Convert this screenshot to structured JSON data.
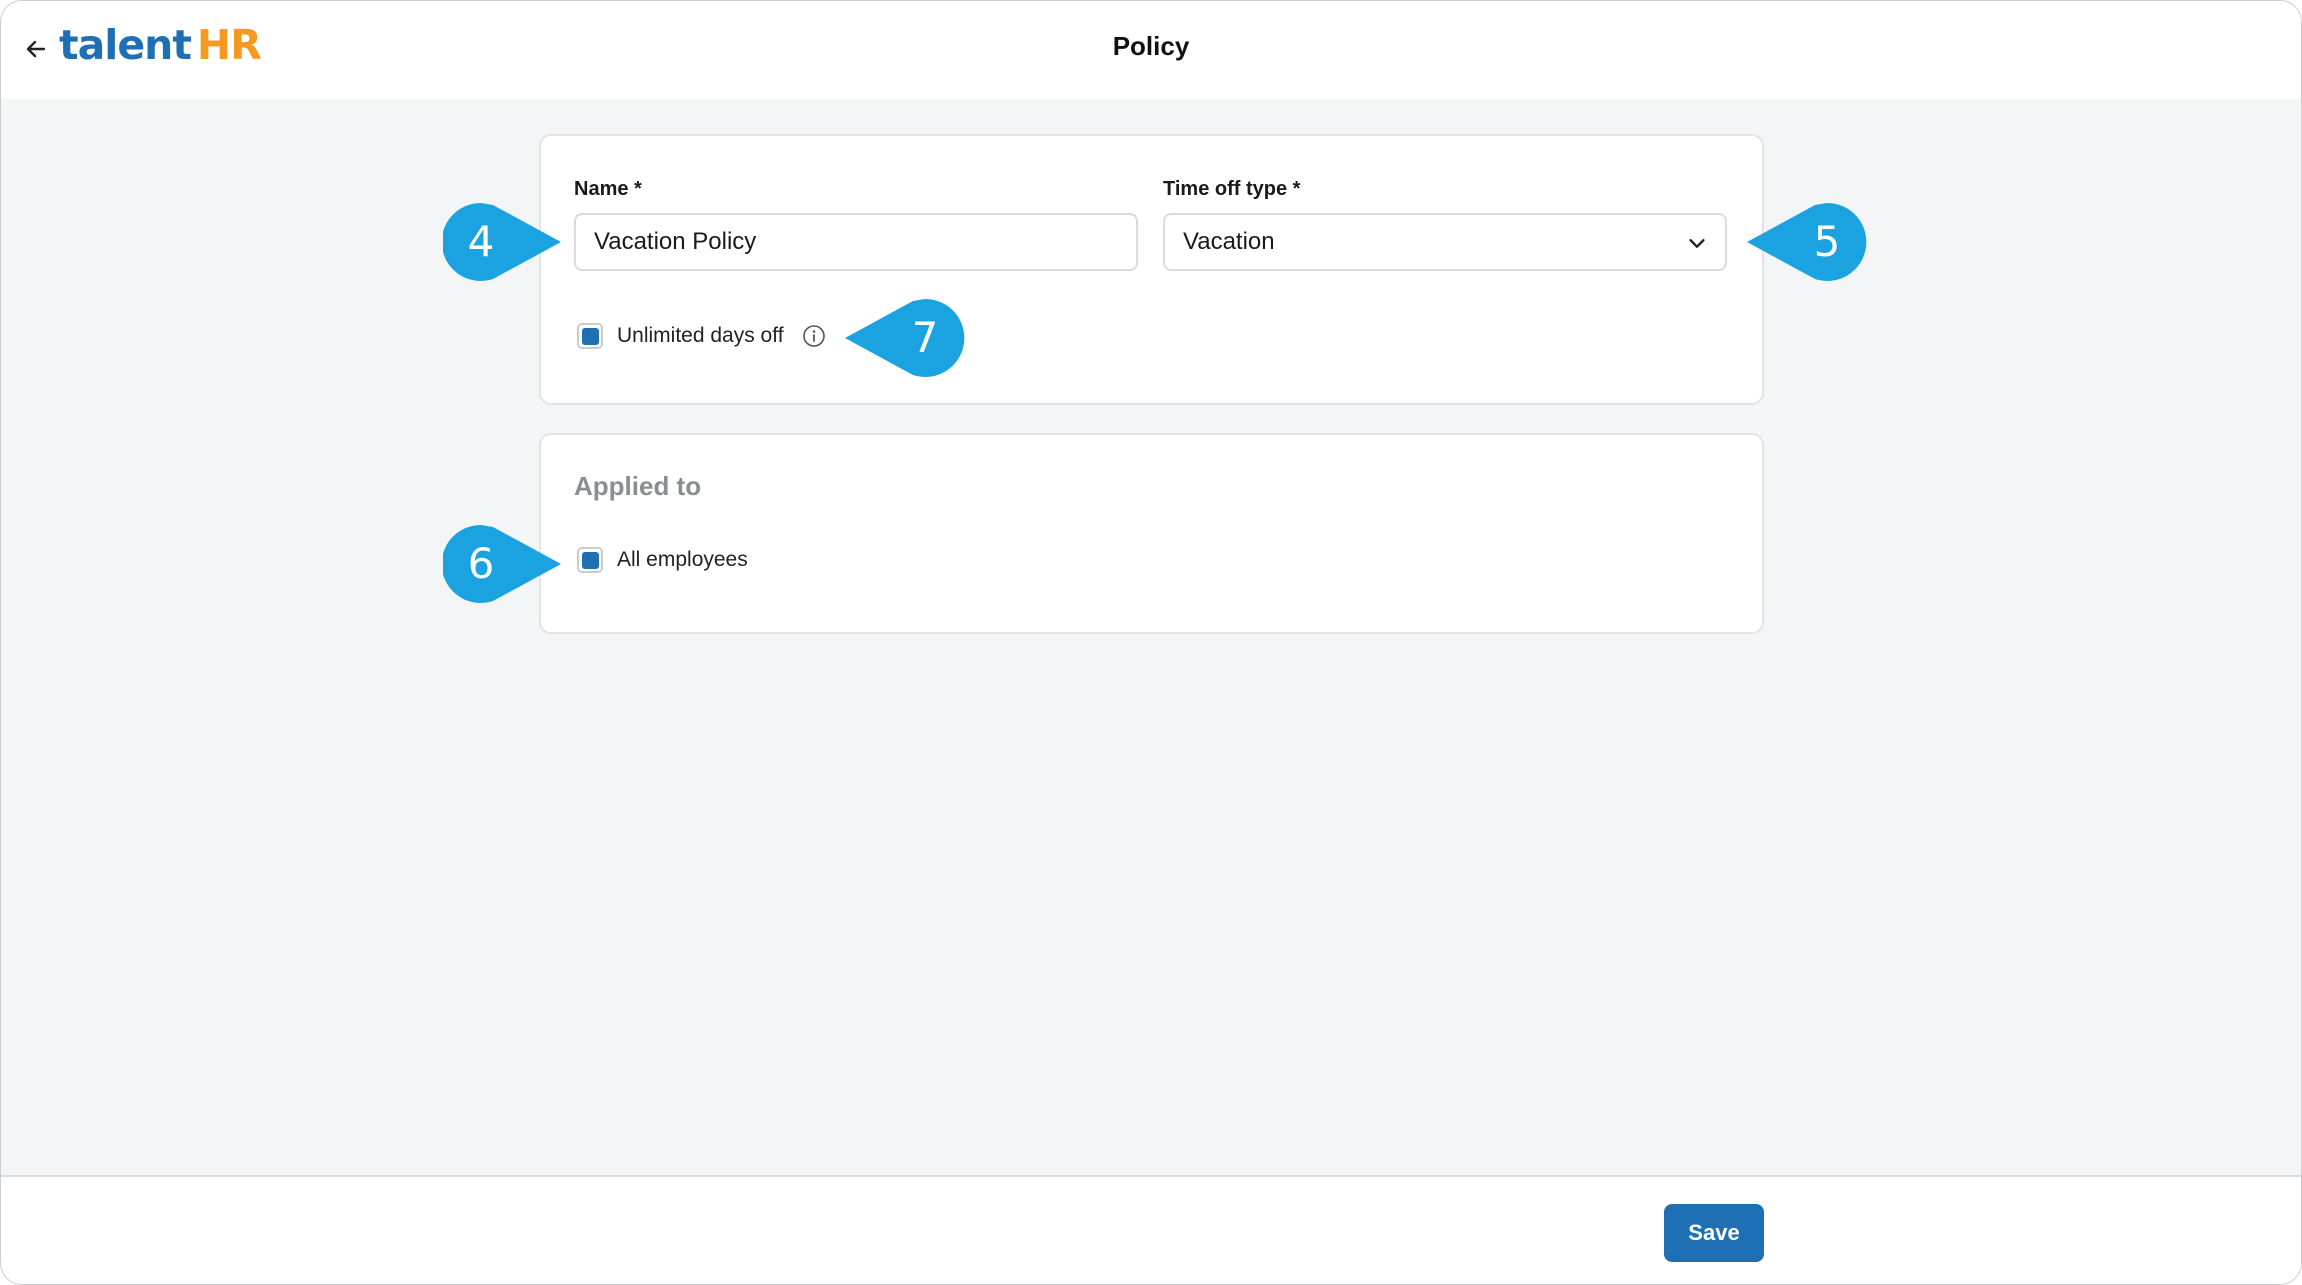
{
  "header": {
    "logo_talent": "talent",
    "logo_hr": "HR",
    "title": "Policy",
    "back_icon": "arrow-left-icon"
  },
  "policy_form": {
    "name_label": "Name *",
    "name_value": "Vacation Policy",
    "type_label": "Time off type *",
    "type_value": "Vacation",
    "unlimited_label": "Unlimited days off",
    "unlimited_checked": true
  },
  "applied_to": {
    "title": "Applied to",
    "all_employees_label": "All employees",
    "all_employees_checked": true
  },
  "callouts": {
    "name": "4",
    "type": "5",
    "applied": "6",
    "unlimited": "7",
    "color": "#1aa3e0"
  },
  "footer": {
    "save_label": "Save"
  },
  "colors": {
    "brand_blue": "#1f6fb5",
    "brand_orange": "#f59a1e",
    "background": "#f4f5f7"
  }
}
